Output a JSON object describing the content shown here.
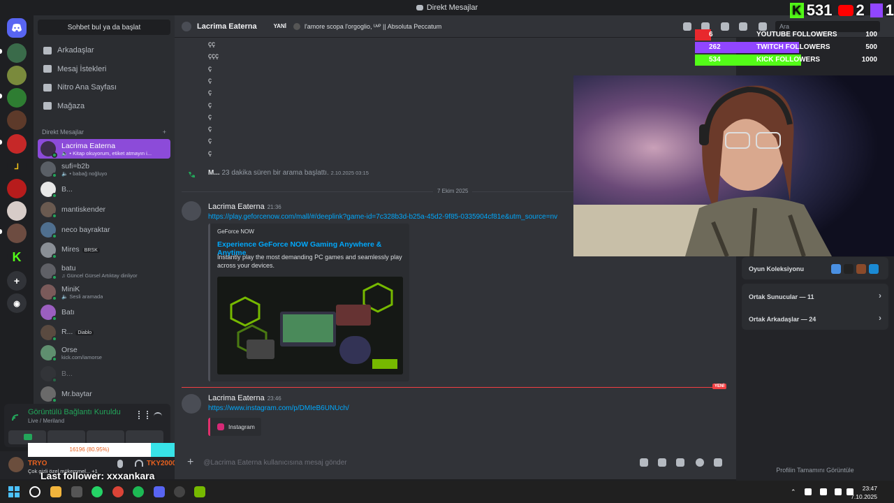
{
  "window": {
    "title": "Direkt Mesajlar"
  },
  "sidebar": {
    "search_label": "Sohbet bul ya da başlat",
    "nav": [
      {
        "label": "Arkadaşlar",
        "icon": "friends-icon"
      },
      {
        "label": "Mesaj İstekleri",
        "icon": "mail-icon"
      },
      {
        "label": "Nitro Ana Sayfası",
        "icon": "nitro-icon"
      },
      {
        "label": "Mağaza",
        "icon": "shop-icon"
      }
    ],
    "dm_header": "Direkt Mesajlar",
    "dm_add": "+",
    "dms": [
      {
        "name": "Lacrima Eaterna",
        "sub": "🔈 • Kitap okuyorum, etiket atmayın i...",
        "active": true
      },
      {
        "name": "sufi=b2b",
        "sub": "🔈 • babağ noğluyo"
      },
      {
        "name": "B...",
        "sub": ""
      },
      {
        "name": "mantiskender",
        "sub": ""
      },
      {
        "name": "neco bayraktar",
        "sub": ""
      },
      {
        "name": "Mires",
        "sub": "",
        "tag": "BRSK"
      },
      {
        "name": "batu",
        "sub": "♫ Güncel Gürsel Artıktay dinliyor"
      },
      {
        "name": "MiniK",
        "sub": "🔈 Sesli aramada"
      },
      {
        "name": "Batı",
        "sub": ""
      },
      {
        "name": "R...",
        "sub": "",
        "tag": "Diablo"
      },
      {
        "name": "Orse",
        "sub": "kick.com/iamorse"
      },
      {
        "name": "B...",
        "sub": ""
      },
      {
        "name": "Mr.baytar",
        "sub": ""
      }
    ]
  },
  "voice": {
    "status": "Görüntülü Bağlantı Kuruldu",
    "channel": "Live / Meriland"
  },
  "overlay_stream": {
    "progress_text": "16196 (80.95%)",
    "progress_fraction": 0.8095,
    "last_follower": "Last follower: xxxankara",
    "user_label": "TRYO",
    "user_status": "Çok gizli özel mükemmel... +1",
    "user_text2": "TKY2000",
    "counts": {
      "kick": "531",
      "youtube": "2",
      "twitch": "1"
    },
    "followers": [
      {
        "label": "YOUTUBE FOLLOWERS",
        "count": "6",
        "goal": "100",
        "fraction": 0.06,
        "color": "#e8282d"
      },
      {
        "label": "TWITCH FOLLOWERS",
        "count": "262",
        "goal": "500",
        "fraction": 0.524,
        "color": "#9146ff"
      },
      {
        "label": "KICK FOLLOWERS",
        "count": "534",
        "goal": "1000",
        "fraction": 0.534,
        "color": "#53fc18"
      }
    ]
  },
  "header": {
    "name": "Lacrima Eaterna",
    "badge": "YANİ",
    "song": "l'amore scopa l'orgoglio, ᵁᵛᴾ || Absoluta Peccatum",
    "search": "Ara"
  },
  "chat": {
    "symbols": [
      "çç",
      "ççç",
      "ç",
      "ç",
      "ç",
      "ç",
      "ç",
      "ç",
      "ç",
      "ç"
    ],
    "call_user": "M...",
    "call_text": "23 dakika süren bir arama başlattı.",
    "call_time": "2.10.2025 03:15",
    "date_sep": "7 Ekim 2025",
    "msg1": {
      "author": "Lacrima Eaterna",
      "time": "21:36",
      "link": "https://play.geforcenow.com/mall/#/deeplink?game-id=7c328b3d-b25a-45d2-9f85-0335904cf81e&utm_source=nv",
      "embed": {
        "provider": "GeForce NOW",
        "title": "Experience GeForce NOW Gaming Anywhere & Anytime",
        "desc": "Instantly play the most demanding PC games and seamlessly play across your devices."
      }
    },
    "new_label": "YENİ",
    "msg2": {
      "author": "Lacrima Eaterna",
      "time": "23:46",
      "link": "https://www.instagram.com/p/DMIeB6UNUch/",
      "embed_label": "Instagram"
    },
    "input_placeholder": "@Lacrima Eaterna kullanıcısına mesaj gönder",
    "input_plus": "+"
  },
  "profile": {
    "game_collection": "Oyun Koleksiyonu",
    "mutual_servers": "Ortak Sunucular — 11",
    "mutual_friends": "Ortak Arkadaşlar — 24",
    "full_profile": "Profilin Tamamını Görüntüle"
  },
  "taskbar": {
    "time": "23:47",
    "date": "7.10.2025"
  },
  "colors": {
    "accent": "#8c4bd9",
    "link": "#00a8fc",
    "online": "#23a55a",
    "new": "#f23f42"
  }
}
